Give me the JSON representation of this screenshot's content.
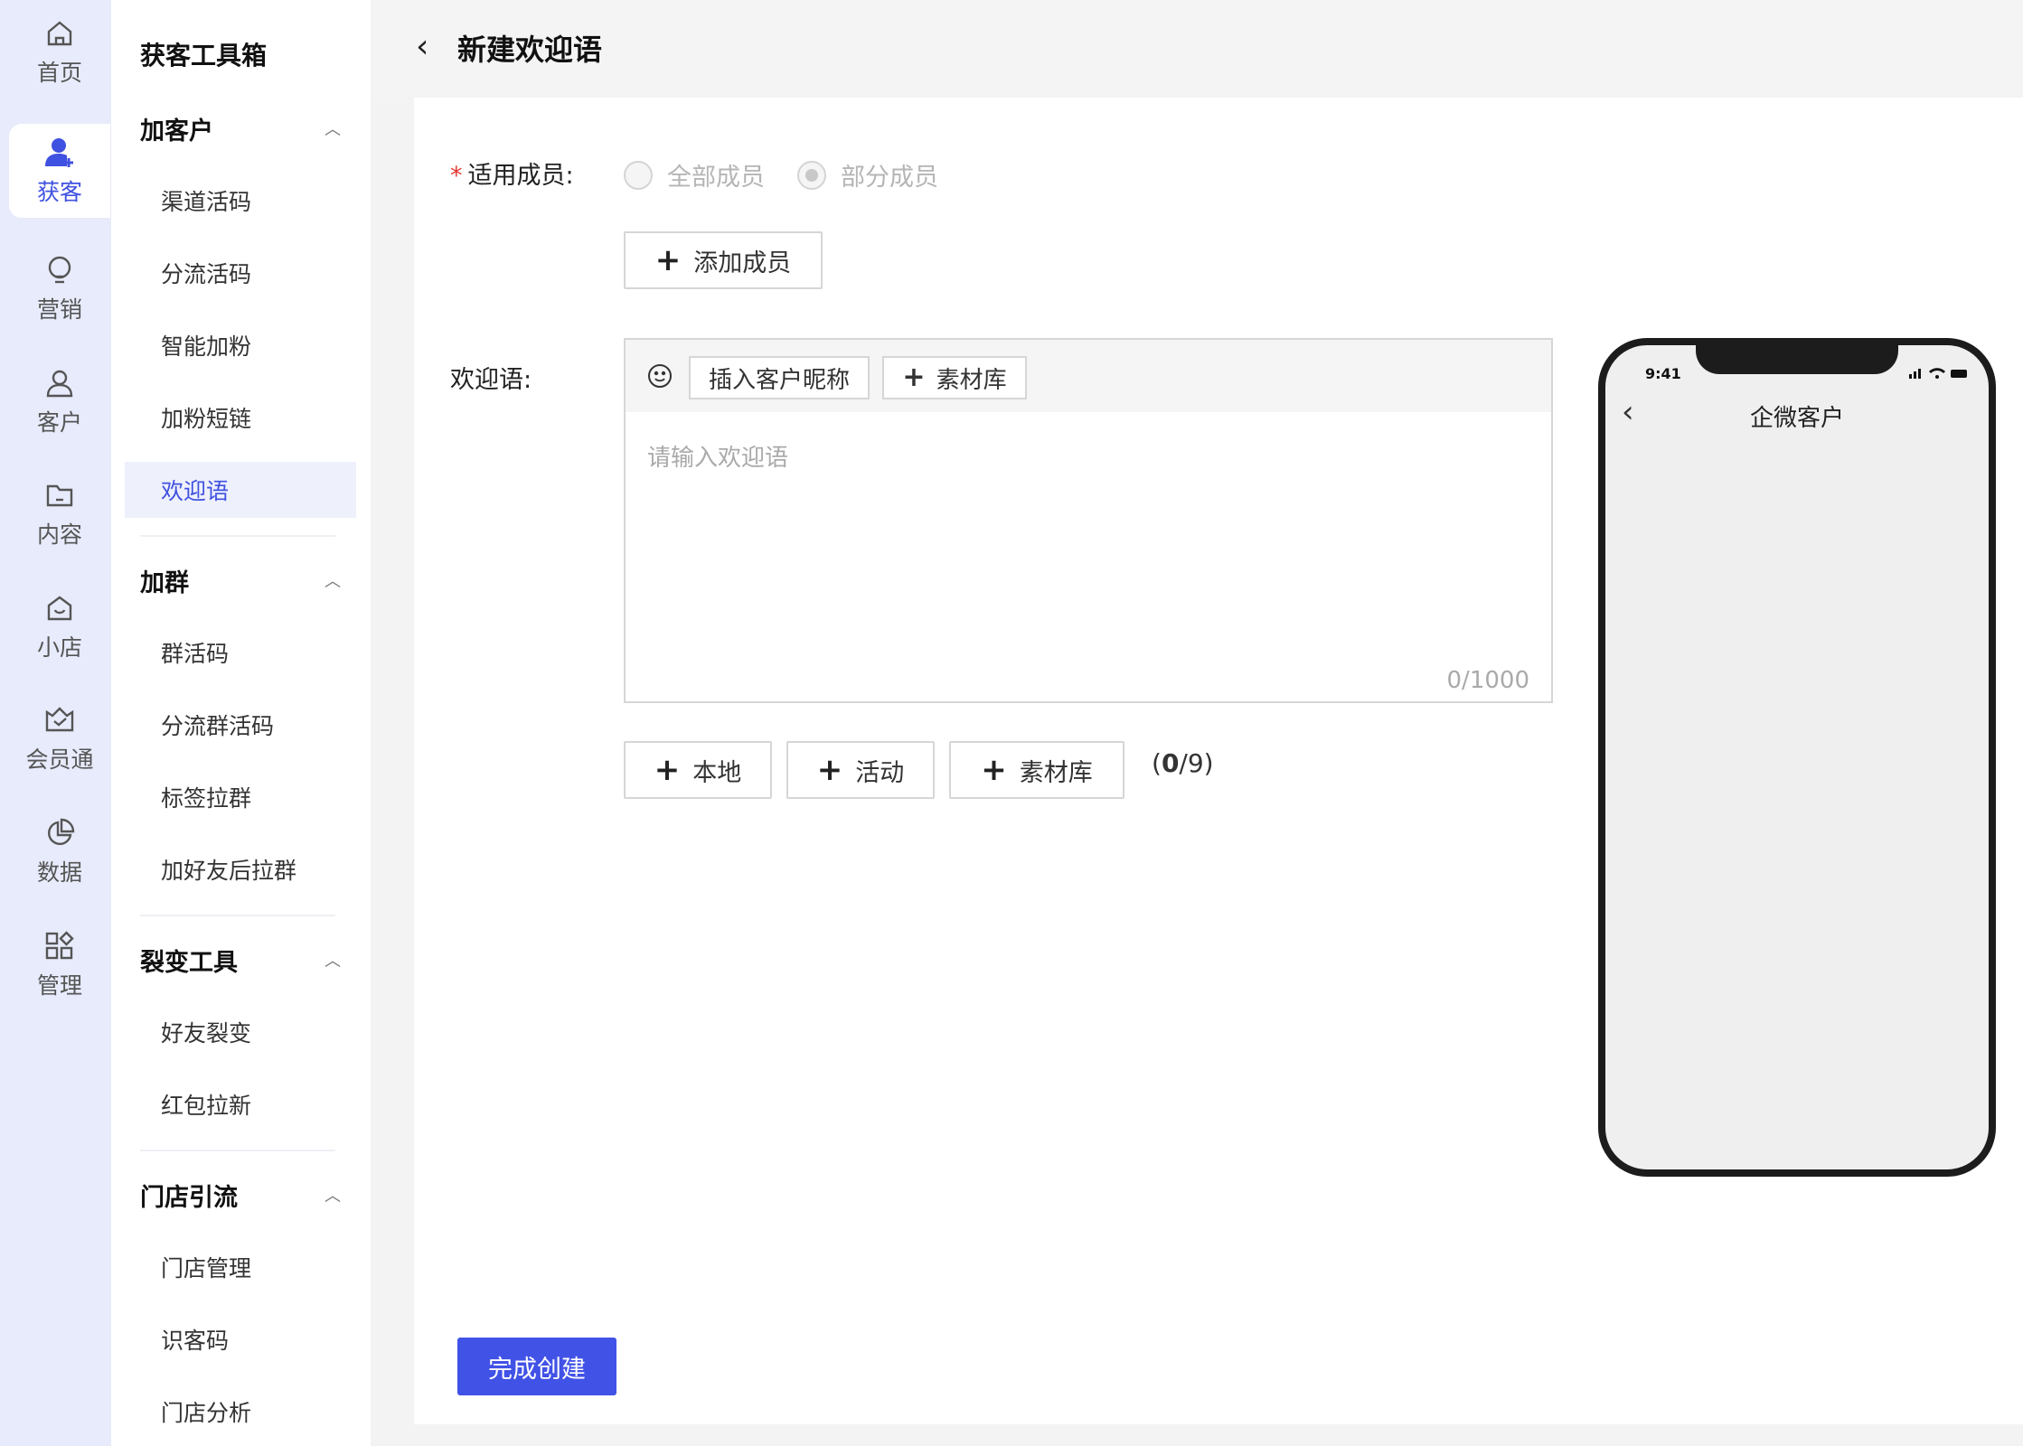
{
  "rail": {
    "items": [
      {
        "label": "首页",
        "icon": "home-icon"
      },
      {
        "label": "获客",
        "icon": "user-add-icon",
        "active": true
      },
      {
        "label": "营销",
        "icon": "bulb-icon"
      },
      {
        "label": "客户",
        "icon": "user-icon"
      },
      {
        "label": "内容",
        "icon": "folder-icon"
      },
      {
        "label": "小店",
        "icon": "shop-icon"
      },
      {
        "label": "会员通",
        "icon": "crown-icon"
      },
      {
        "label": "数据",
        "icon": "pie-chart-icon"
      },
      {
        "label": "管理",
        "icon": "apps-icon"
      }
    ]
  },
  "menu": {
    "title": "获客工具箱",
    "groups": [
      {
        "label": "加客户",
        "items": [
          "渠道活码",
          "分流活码",
          "智能加粉",
          "加粉短链",
          "欢迎语"
        ]
      },
      {
        "label": "加群",
        "items": [
          "群活码",
          "分流群活码",
          "标签拉群",
          "加好友后拉群"
        ]
      },
      {
        "label": "裂变工具",
        "items": [
          "好友裂变",
          "红包拉新"
        ]
      },
      {
        "label": "门店引流",
        "items": [
          "门店管理",
          "识客码",
          "门店分析"
        ]
      }
    ],
    "active_item": "欢迎语"
  },
  "header": {
    "back_icon": "chevron-left-icon",
    "title": "新建欢迎语"
  },
  "form": {
    "members_label": "适用成员:",
    "members_required": "*",
    "radio_all": "全部成员",
    "radio_partial": "部分成员",
    "selected_radio": "部分成员",
    "add_member_button": "添加成员",
    "welcome_label": "欢迎语:",
    "toolbar": {
      "emoji_icon": "smile-icon",
      "insert_nickname": "插入客户昵称",
      "material_library": "素材库"
    },
    "textarea_placeholder": "请输入欢迎语",
    "textarea_value": "",
    "char_counter": "0/1000",
    "attach_buttons": [
      "本地",
      "活动",
      "素材库"
    ],
    "attach_count_open": "(",
    "attach_count_current": "0",
    "attach_count_rest": "/9)",
    "submit_button": "完成创建"
  },
  "phone": {
    "time": "9:41",
    "title": "企微客户"
  },
  "colors": {
    "accent": "#4152e6",
    "rail_bg": "#e7ebfb",
    "active_item_bg": "#eef0fc",
    "required": "#e53935"
  }
}
